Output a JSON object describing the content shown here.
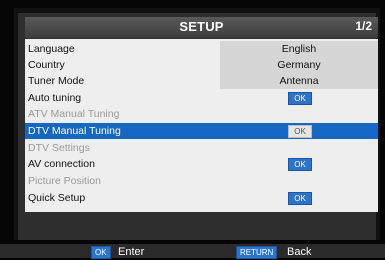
{
  "header": {
    "title": "SETUP",
    "page": "1/2"
  },
  "menu": {
    "rows": [
      {
        "label": "Language",
        "value": "English"
      },
      {
        "label": "Country",
        "value": "Germany"
      },
      {
        "label": "Tuner Mode",
        "value": "Antenna"
      },
      {
        "label": "Auto tuning",
        "button": "OK"
      },
      {
        "label": "ATV Manual Tuning"
      },
      {
        "label": "DTV Manual Tuning",
        "button": "OK"
      },
      {
        "label": "DTV Settings"
      },
      {
        "label": "AV connection",
        "button": "OK"
      },
      {
        "label": "Picture Position"
      },
      {
        "label": "Quick Setup",
        "button": "OK"
      }
    ],
    "selected_index": 5
  },
  "footer": {
    "enter_key": "OK",
    "enter_label": "Enter",
    "back_key": "RETURN",
    "back_label": "Back"
  },
  "colors": {
    "selection": "#1468c4",
    "button": "#2d73c9",
    "menu_background": "#eeeeee",
    "value_background": "#d6d6d6"
  }
}
